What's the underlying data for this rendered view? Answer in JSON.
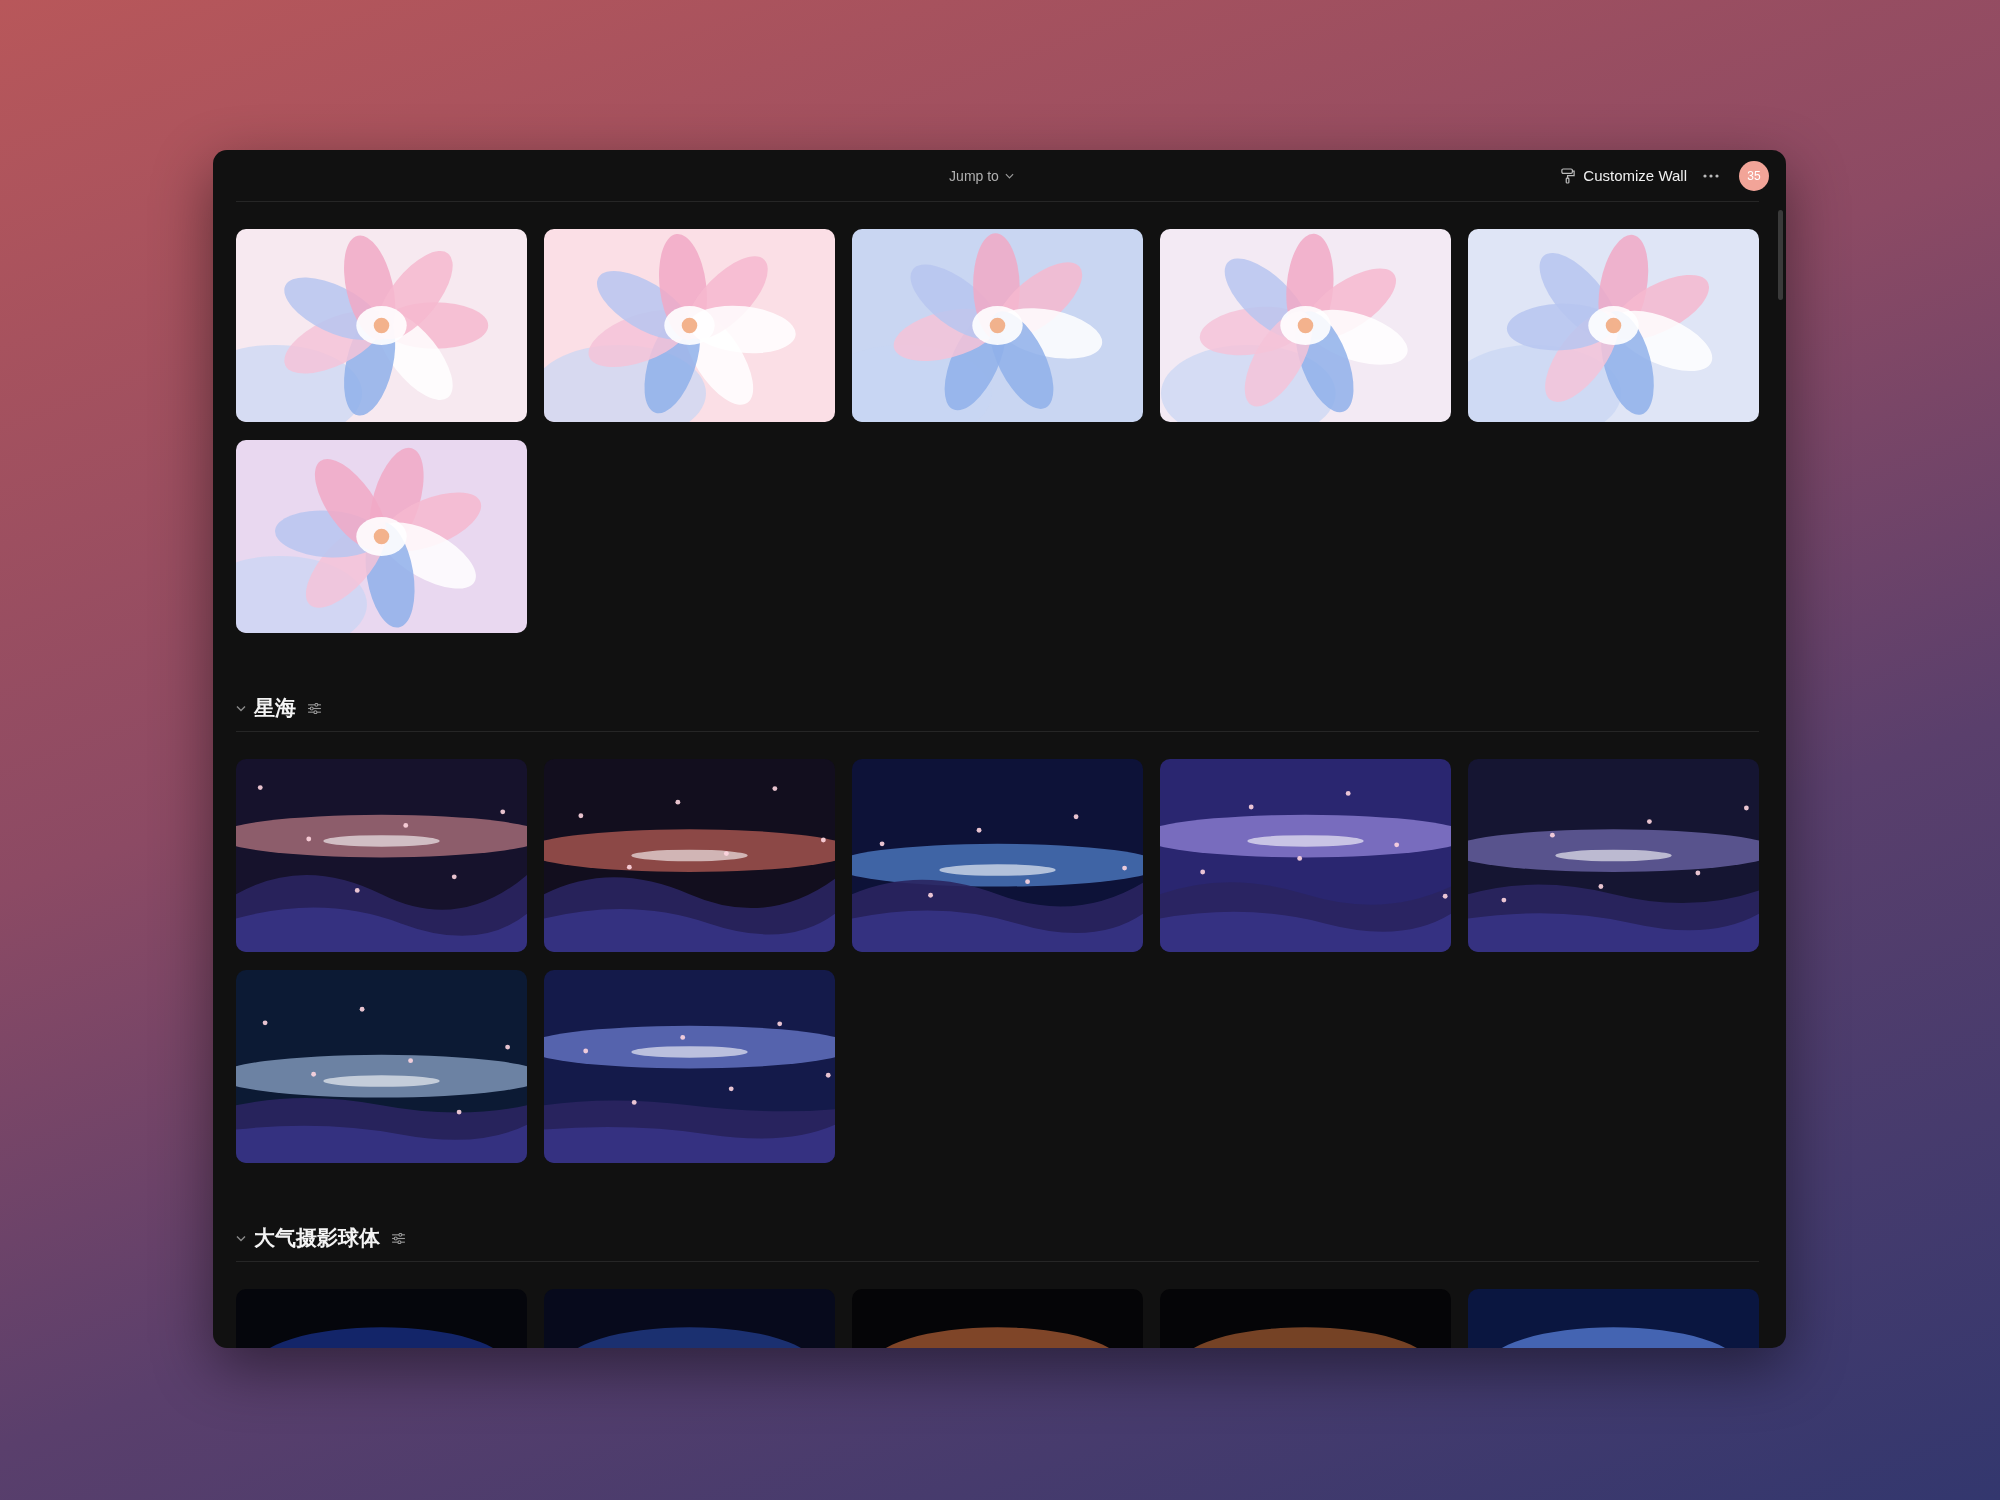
{
  "header": {
    "jump_to": "Jump to",
    "customize": "Customize Wall",
    "avatar": "35"
  },
  "sections": [
    {
      "kind": "flowers"
    },
    {
      "title": "星海",
      "expanded": true,
      "kind": "space"
    },
    {
      "title": "大气摄影球体",
      "expanded": true,
      "kind": "spheres"
    }
  ]
}
